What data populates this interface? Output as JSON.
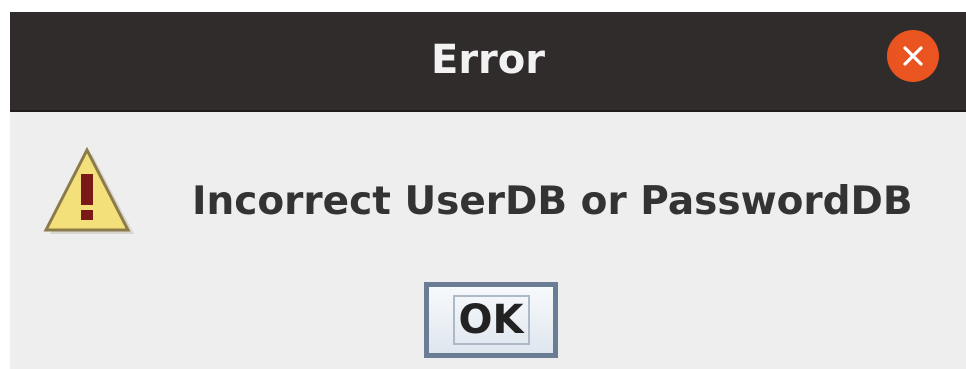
{
  "window": {
    "title": "Error",
    "close_icon": "close-icon"
  },
  "dialog": {
    "icon": "warning-icon",
    "message": "Incorrect UserDB or PasswordDB",
    "ok_label": "OK"
  },
  "colors": {
    "titlebar": "#2f2c2b",
    "close_button": "#e95420",
    "body": "#eeeeee",
    "warning_fill": "#f3e07a",
    "button_border": "#6b7d94"
  }
}
